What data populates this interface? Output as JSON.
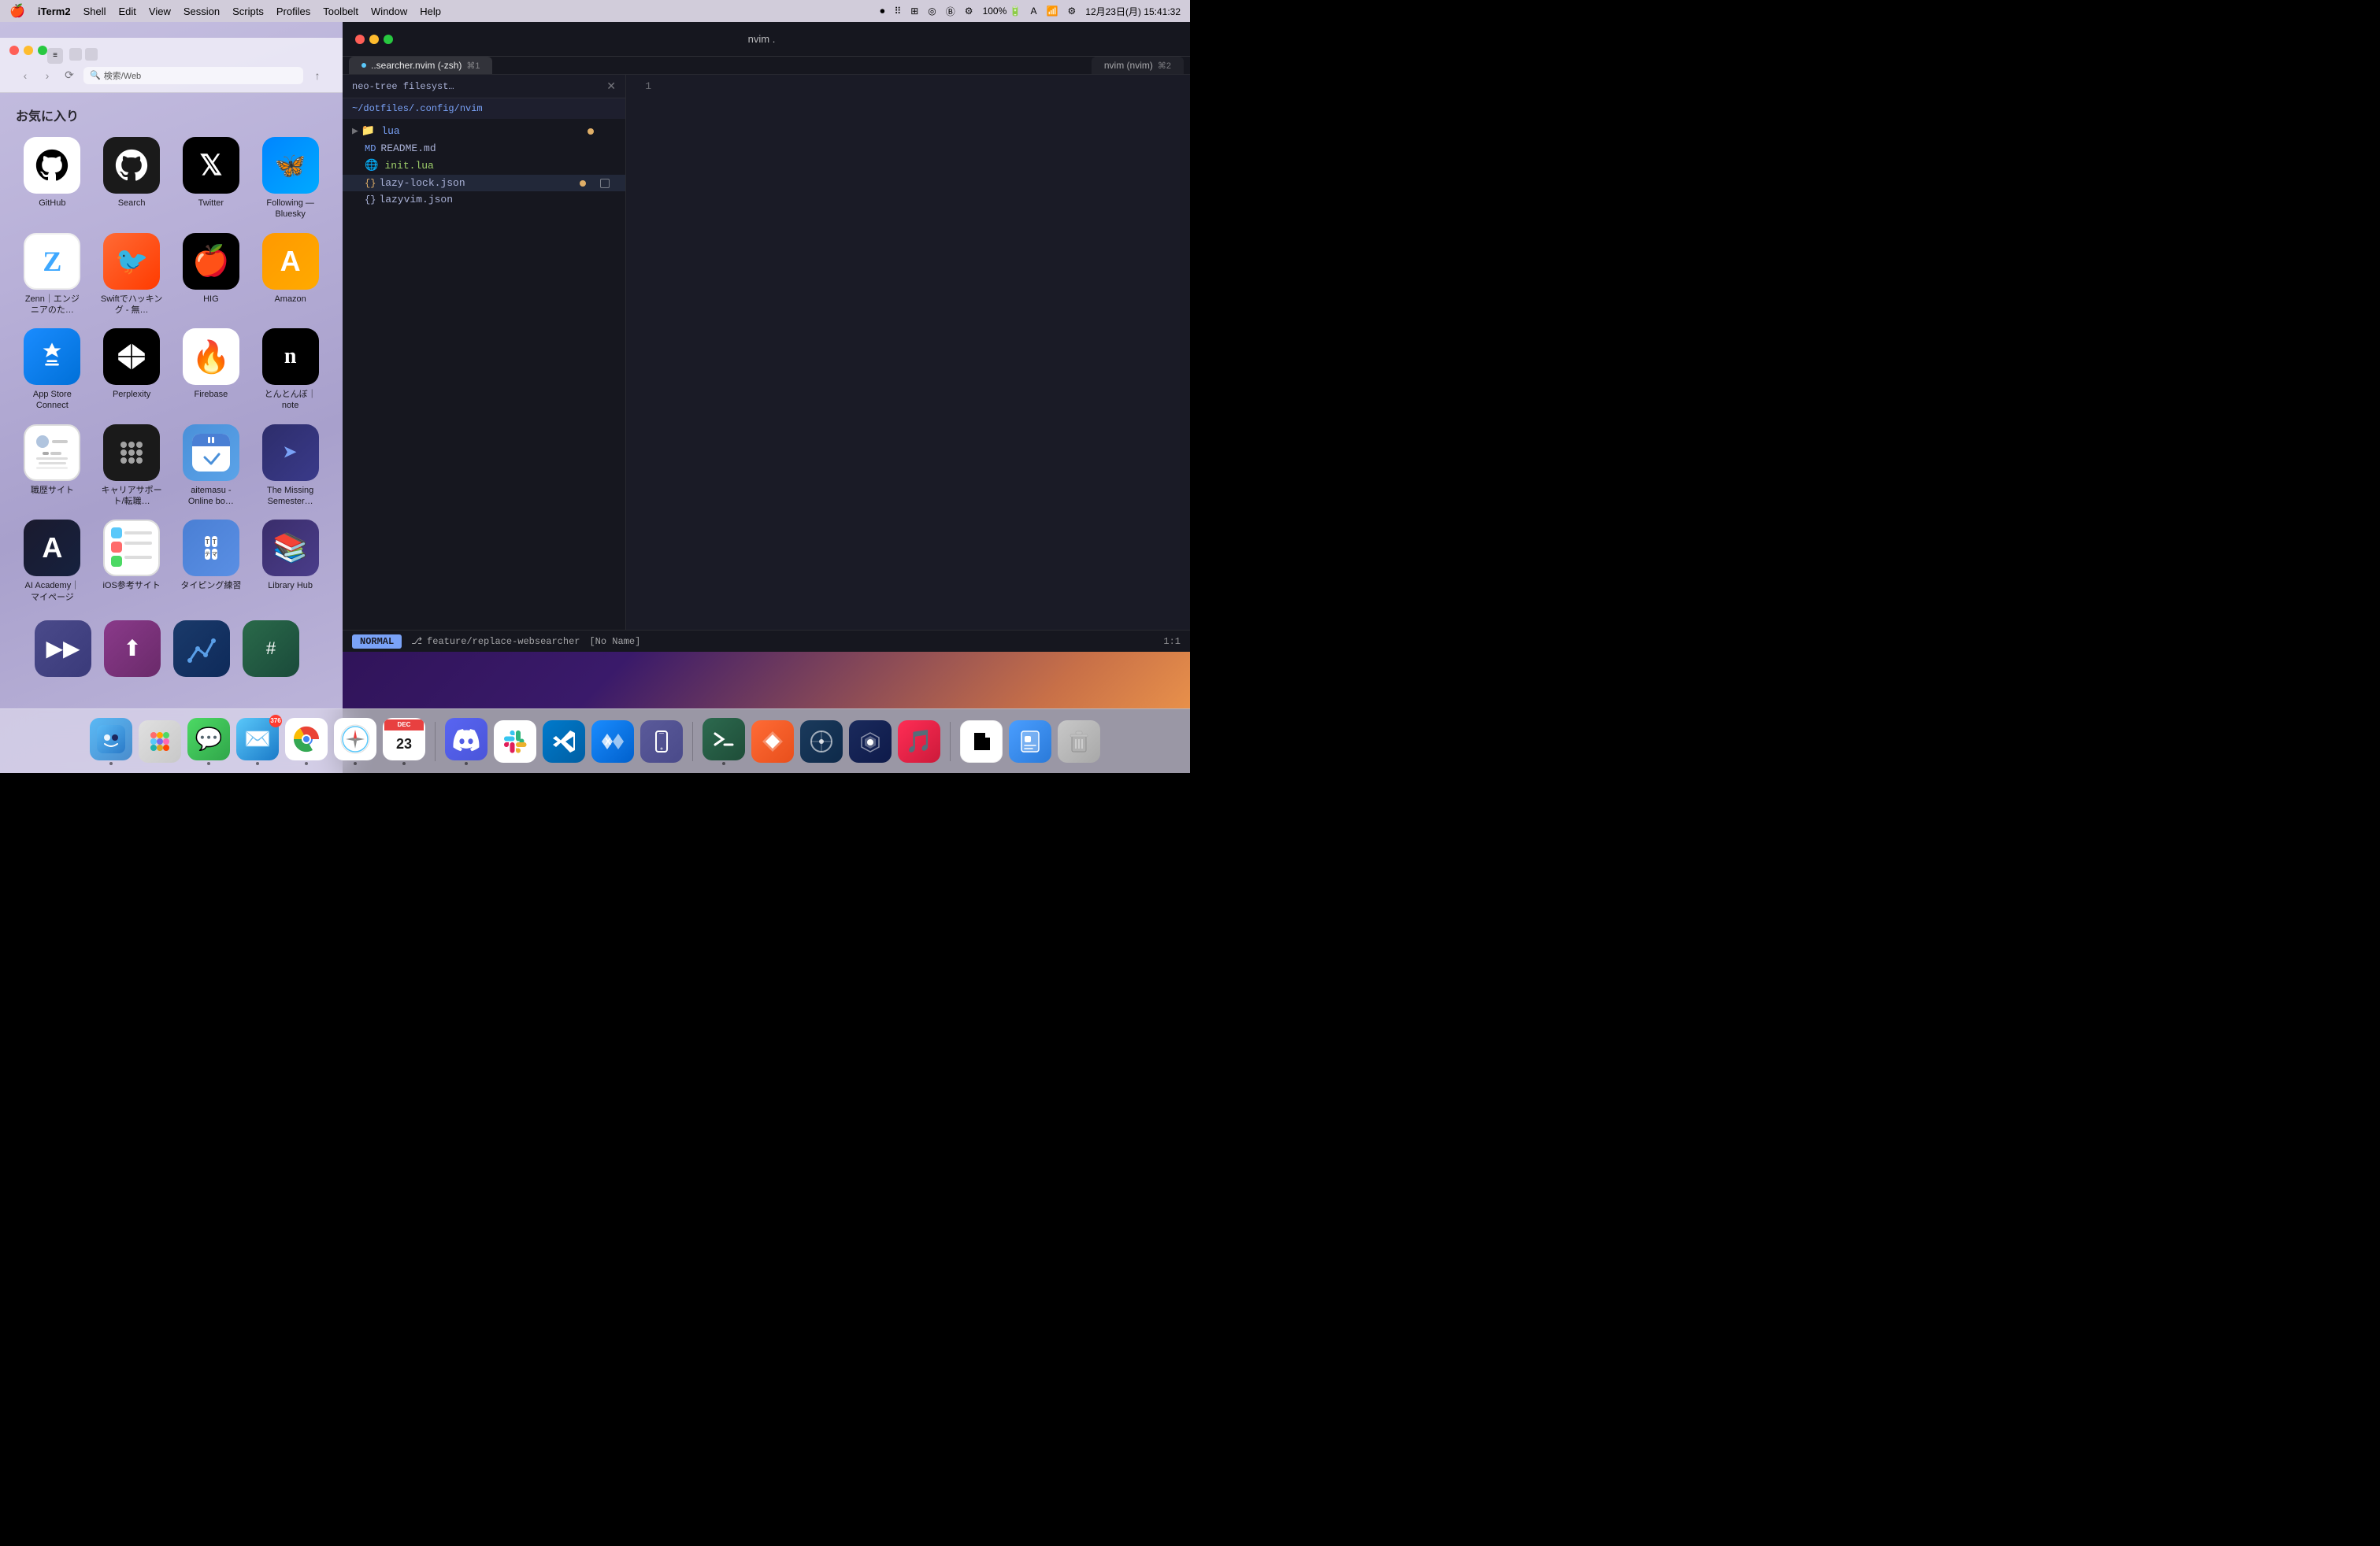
{
  "menubar": {
    "apple": "🍎",
    "appName": "iTerm2",
    "menuItems": [
      "Shell",
      "Edit",
      "View",
      "Session",
      "Scripts",
      "Profiles",
      "Toolbelt",
      "Window",
      "Help"
    ],
    "rightItems": {
      "record": "⏺",
      "clock": "12月23日(月) 15:41:32",
      "battery": "100%",
      "wifi": "WiFi",
      "bluetooth": "BT"
    }
  },
  "launchpad": {
    "title": "お気に入り",
    "searchPlaceholder": "検索/Web",
    "apps": [
      {
        "id": "github-white",
        "label": "GitHub",
        "type": "github-white"
      },
      {
        "id": "github-dark",
        "label": "Search",
        "type": "github-dark"
      },
      {
        "id": "twitter",
        "label": "Twitter",
        "type": "twitter"
      },
      {
        "id": "bluesky",
        "label": "Following — Bluesky",
        "type": "bluesky"
      },
      {
        "id": "zenn",
        "label": "Zenn｜エンジニアのた…",
        "type": "zenn"
      },
      {
        "id": "swift",
        "label": "Swiftでハッキング - 無…",
        "type": "swift"
      },
      {
        "id": "hig",
        "label": "HIG",
        "type": "hig"
      },
      {
        "id": "amazon",
        "label": "Amazon",
        "type": "amazon"
      },
      {
        "id": "appstore",
        "label": "App Store Connect",
        "type": "appstore"
      },
      {
        "id": "perplexity",
        "label": "Perplexity",
        "type": "perplexity"
      },
      {
        "id": "firebase",
        "label": "Firebase",
        "type": "firebase"
      },
      {
        "id": "note",
        "label": "とんとんぼ｜note",
        "type": "note"
      },
      {
        "id": "resume",
        "label": "職歴サイト",
        "type": "resume"
      },
      {
        "id": "career",
        "label": "キャリアサポート/転職…",
        "type": "career"
      },
      {
        "id": "aitemasu",
        "label": "aitemasu - Online bo…",
        "type": "aitemasu"
      },
      {
        "id": "missing",
        "label": "The Missing Semester…",
        "type": "missing"
      },
      {
        "id": "ai-academy",
        "label": "AI Academy｜マイページ",
        "type": "ai-academy"
      },
      {
        "id": "ios-ref",
        "label": "iOS参考サイト",
        "type": "ios-ref"
      },
      {
        "id": "typing",
        "label": "タイピング練習",
        "type": "typing"
      },
      {
        "id": "library",
        "label": "Library Hub",
        "type": "library"
      }
    ],
    "bottomApps": [
      {
        "id": "bot1",
        "label": "",
        "type": "forward"
      },
      {
        "id": "bot2",
        "label": "",
        "type": "purple"
      },
      {
        "id": "bot3",
        "label": "",
        "type": "graph"
      },
      {
        "id": "bot4",
        "label": "",
        "type": "hash"
      }
    ]
  },
  "terminal": {
    "title": "nvim .",
    "tabs": [
      {
        "label": "..searcher.nvim (-zsh)",
        "shortcut": "⌘1",
        "active": true
      },
      {
        "label": "nvim (nvim)",
        "shortcut": "⌘2",
        "active": false
      }
    ],
    "neotree": {
      "title": "neo-tree filesyst…",
      "path": "~/dotfiles/.config/nvim",
      "items": [
        {
          "type": "folder",
          "name": "lua",
          "expanded": true,
          "dotColor": "orange"
        },
        {
          "type": "file",
          "name": "README.md",
          "icon": "📄",
          "iconColor": "#a9b1d6"
        },
        {
          "type": "file",
          "name": "init.lua",
          "icon": "🌐",
          "iconColor": "#9ece6a"
        },
        {
          "type": "file",
          "name": "lazy-lock.json",
          "icon": "{}",
          "selected": true,
          "dotColor": "orange",
          "hasSquare": true
        },
        {
          "type": "file",
          "name": "lazyvim.json",
          "icon": "{}",
          "dotColor": "blue"
        }
      ]
    },
    "editor": {
      "lineNumbers": [
        "1"
      ],
      "content": ""
    },
    "statusbar": {
      "mode": "NORMAL",
      "gitBranch": "feature/replace-websearcher",
      "filename": "[No Name]",
      "position": "1:1"
    }
  },
  "dock": {
    "items": [
      {
        "id": "finder",
        "type": "finder",
        "label": "Finder",
        "hasIndicator": true
      },
      {
        "id": "launchpad",
        "type": "launchpad-dock",
        "label": "Launchpad",
        "hasIndicator": false
      },
      {
        "id": "messages",
        "type": "messages",
        "label": "Messages",
        "hasIndicator": true
      },
      {
        "id": "mail",
        "type": "mail",
        "label": "Mail",
        "badge": "376",
        "hasIndicator": true
      },
      {
        "id": "chrome",
        "type": "chrome",
        "label": "Chrome",
        "hasIndicator": true
      },
      {
        "id": "safari",
        "type": "safari",
        "label": "Safari",
        "hasIndicator": true
      },
      {
        "id": "calendar",
        "type": "calendar",
        "label": "Calendar",
        "hasIndicator": true
      },
      {
        "id": "discord",
        "type": "discord",
        "label": "Discord",
        "hasIndicator": true
      },
      {
        "id": "slack",
        "type": "slack",
        "label": "Slack",
        "hasIndicator": false
      },
      {
        "id": "vscode",
        "type": "vscode",
        "label": "VSCode",
        "hasIndicator": false
      },
      {
        "id": "xcode",
        "type": "xcode",
        "label": "Xcode",
        "hasIndicator": false
      },
      {
        "id": "simulator",
        "type": "simulator",
        "label": "Simulator",
        "hasIndicator": false
      },
      {
        "id": "iterm",
        "type": "iterm",
        "label": "iTerm2",
        "hasIndicator": true
      },
      {
        "id": "prompt",
        "type": "prompt",
        "label": "Prompt",
        "hasIndicator": false
      },
      {
        "id": "xscope",
        "type": "xscope",
        "label": "xScope",
        "hasIndicator": false
      },
      {
        "id": "proxyman",
        "type": "proxyman",
        "label": "Proxyman",
        "hasIndicator": false
      },
      {
        "id": "music",
        "type": "music",
        "label": "Music",
        "hasIndicator": false
      },
      {
        "id": "notion",
        "type": "notion",
        "label": "Notion",
        "hasIndicator": false
      },
      {
        "id": "preview",
        "type": "preview",
        "label": "Preview",
        "hasIndicator": false
      },
      {
        "id": "trash",
        "type": "trash",
        "label": "Trash",
        "hasIndicator": false
      }
    ]
  }
}
